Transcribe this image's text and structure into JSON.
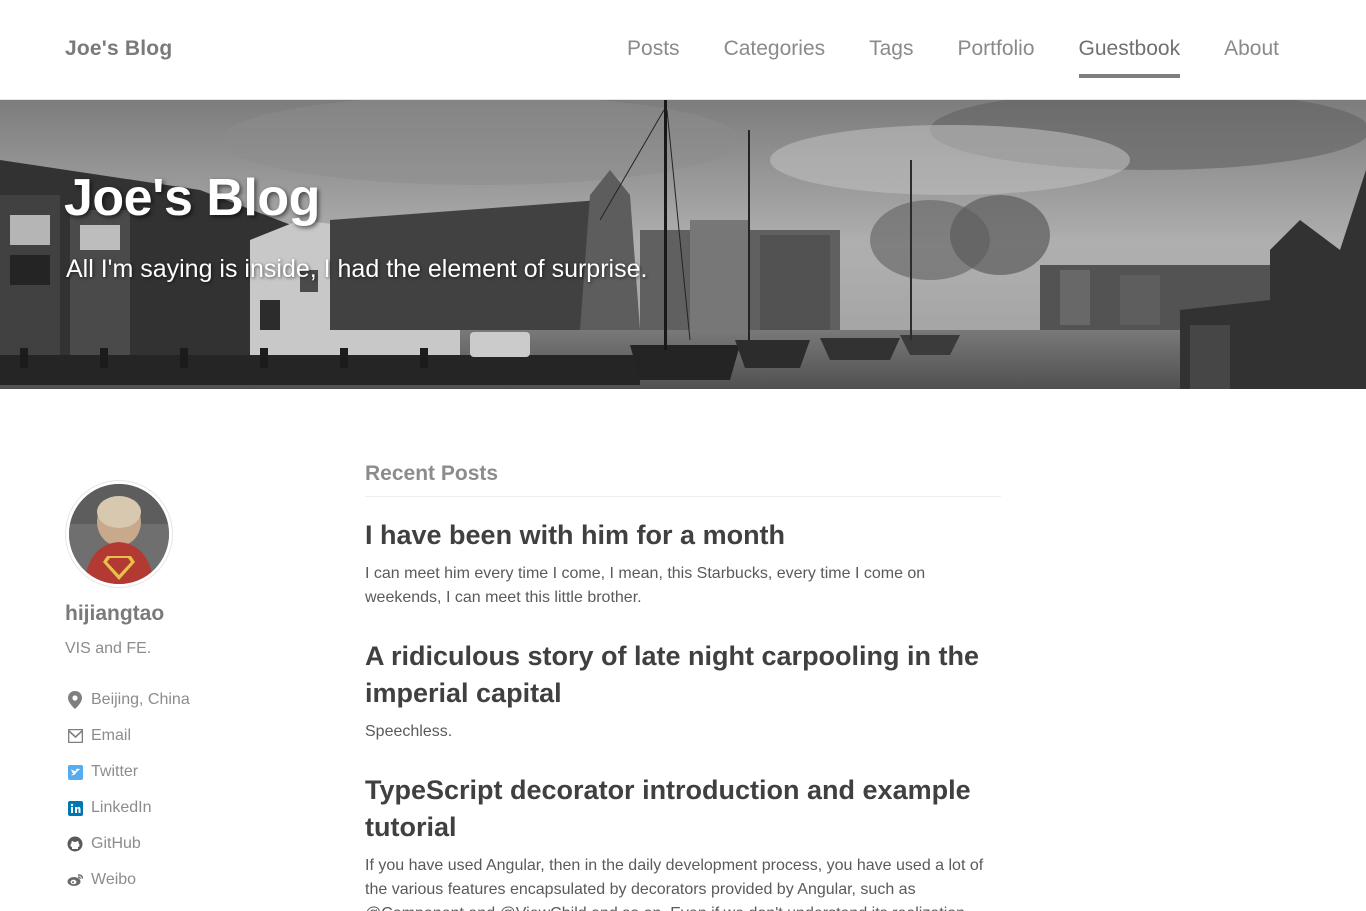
{
  "navbar": {
    "brand": "Joe's Blog",
    "items": [
      {
        "label": "Posts",
        "active": false
      },
      {
        "label": "Categories",
        "active": false
      },
      {
        "label": "Tags",
        "active": false
      },
      {
        "label": "Portfolio",
        "active": false
      },
      {
        "label": "Guestbook",
        "active": true
      },
      {
        "label": "About",
        "active": false
      }
    ]
  },
  "hero": {
    "title": "Joe's Blog",
    "subtitle": "All I'm saying is inside, I had the element of surprise."
  },
  "sidebar": {
    "username": "hijiangtao",
    "bio": "VIS and FE.",
    "links": [
      {
        "icon": "location-pin-icon",
        "label": "Beijing, China"
      },
      {
        "icon": "email-icon",
        "label": "Email"
      },
      {
        "icon": "twitter-icon",
        "label": "Twitter"
      },
      {
        "icon": "linkedin-icon",
        "label": "LinkedIn"
      },
      {
        "icon": "github-icon",
        "label": "GitHub"
      },
      {
        "icon": "weibo-icon",
        "label": "Weibo"
      }
    ]
  },
  "main": {
    "section_title": "Recent Posts",
    "posts": [
      {
        "title": "I have been with him for a month",
        "excerpt": "I can meet him every time I come, I mean, this Starbucks, every time I come on weekends, I can meet this little brother."
      },
      {
        "title": "A ridiculous story of late night carpooling in the imperial capital",
        "excerpt": "Speechless."
      },
      {
        "title": "TypeScript decorator introduction and example tutorial",
        "excerpt": "If you have used Angular, then in the daily development process, you have used a lot of the various features encapsulated by decorators provided by Angular, such as @Component and @ViewChild and so on. Even if we don't understand its realization"
      }
    ]
  },
  "colors": {
    "text": "#404040",
    "muted": "#8c8c8c",
    "twitter": "#55acee",
    "linkedin": "#0077b5"
  }
}
